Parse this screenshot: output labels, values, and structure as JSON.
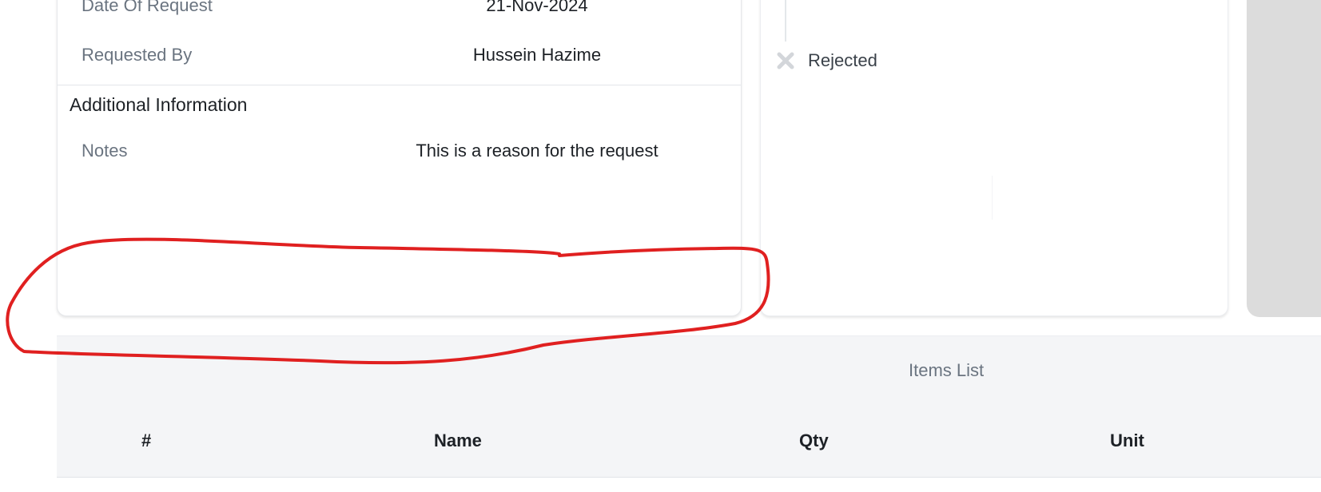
{
  "details": {
    "date_label": "Date Of Request",
    "date_value": "21-Nov-2024",
    "requested_by_label": "Requested By",
    "requested_by_value": "Hussein Hazime",
    "additional_title": "Additional Information",
    "notes_label": "Notes",
    "notes_value": "This is a reason for the request"
  },
  "status": {
    "label": "Rejected",
    "icon": "close-icon"
  },
  "items": {
    "title": "Items List",
    "columns": [
      "#",
      "Name",
      "Qty",
      "Unit"
    ]
  },
  "colors": {
    "annotation": "#e02020",
    "side_panel": "#dcdcdc",
    "header_bg": "#f4f5f7"
  }
}
